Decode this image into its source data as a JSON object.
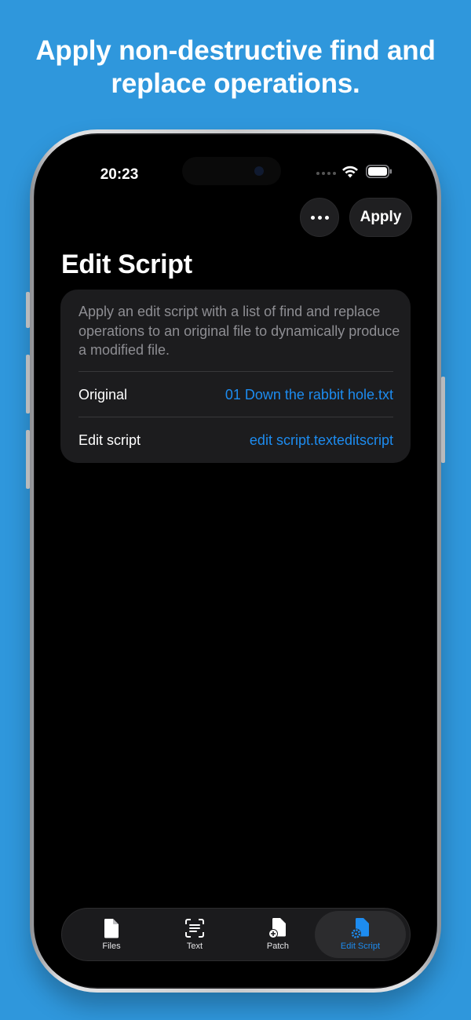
{
  "headline": "Apply non-destructive find and replace operations.",
  "status_bar": {
    "time": "20:23"
  },
  "nav": {
    "more_icon": "ellipsis-icon",
    "apply_label": "Apply"
  },
  "page": {
    "title": "Edit Script",
    "description": "Apply an edit script with a list of find and replace operations to an original file to dynamically produce a modified file.",
    "rows": [
      {
        "label": "Original",
        "value": "01 Down the rabbit hole.txt"
      },
      {
        "label": "Edit script",
        "value": "edit script.texteditscript"
      }
    ]
  },
  "tabbar": {
    "tabs": [
      {
        "label": "Files",
        "icon": "document-icon",
        "active": false
      },
      {
        "label": "Text",
        "icon": "text-scan-icon",
        "active": false
      },
      {
        "label": "Patch",
        "icon": "document-plus-icon",
        "active": false
      },
      {
        "label": "Edit Script",
        "icon": "document-gear-icon",
        "active": true
      }
    ]
  },
  "colors": {
    "background": "#2F97DC",
    "accent": "#1D8CF0",
    "screen": "#000000",
    "card": "#1C1C1E"
  }
}
